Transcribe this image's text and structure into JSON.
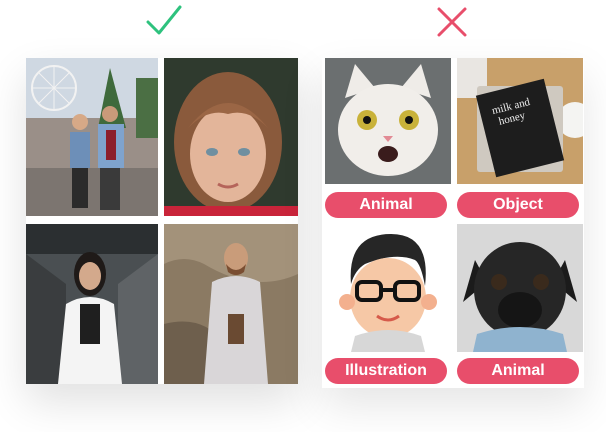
{
  "good_examples": {
    "mark_icon": "check-icon",
    "mark_color": "#2ec27e",
    "images": [
      {
        "icon": "couple-photo"
      },
      {
        "icon": "girl-portrait-photo"
      },
      {
        "icon": "woman-portrait-photo"
      },
      {
        "icon": "man-portrait-photo"
      }
    ]
  },
  "bad_examples": {
    "mark_icon": "cross-icon",
    "mark_color": "#e84e6b",
    "tiles": [
      {
        "icon": "cat-photo",
        "label": "Animal"
      },
      {
        "icon": "book-photo",
        "label": "Object"
      },
      {
        "icon": "cartoon-man-illustration",
        "label": "Illustration"
      },
      {
        "icon": "pug-photo",
        "label": "Animal"
      }
    ],
    "label_color": "#e84e6b"
  }
}
